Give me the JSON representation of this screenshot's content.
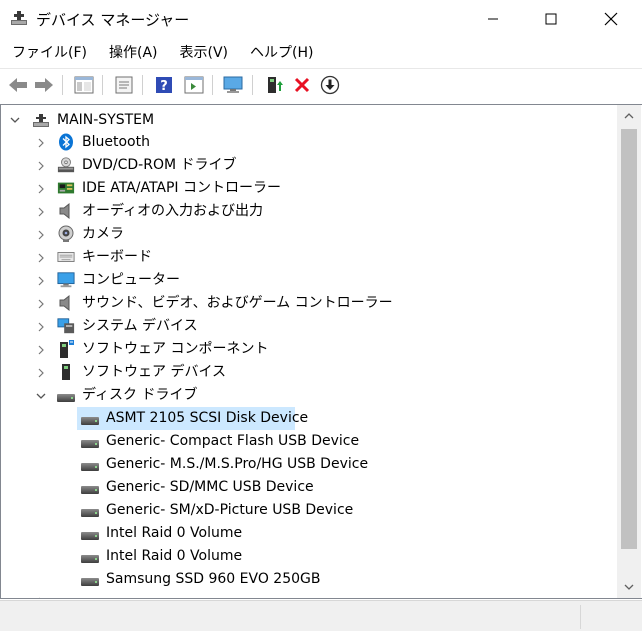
{
  "window": {
    "title": "デバイス マネージャー"
  },
  "menu": {
    "items": [
      "ファイル(F)",
      "操作(A)",
      "表示(V)",
      "ヘルプ(H)"
    ]
  },
  "tree": {
    "root": "MAIN-SYSTEM",
    "categories": [
      {
        "label": "Bluetooth",
        "icon": "bluetooth-icon",
        "expanded": false
      },
      {
        "label": "DVD/CD-ROM ドライブ",
        "icon": "optical-drive-icon",
        "expanded": false
      },
      {
        "label": "IDE ATA/ATAPI コントローラー",
        "icon": "ide-controller-icon",
        "expanded": false
      },
      {
        "label": "オーディオの入力および出力",
        "icon": "speaker-icon",
        "expanded": false
      },
      {
        "label": "カメラ",
        "icon": "camera-icon",
        "expanded": false
      },
      {
        "label": "キーボード",
        "icon": "keyboard-icon",
        "expanded": false
      },
      {
        "label": "コンピューター",
        "icon": "monitor-icon",
        "expanded": false
      },
      {
        "label": "サウンド、ビデオ、およびゲーム コントローラー",
        "icon": "speaker-icon",
        "expanded": false
      },
      {
        "label": "システム デバイス",
        "icon": "system-devices-icon",
        "expanded": false
      },
      {
        "label": "ソフトウェア コンポーネント",
        "icon": "software-component-icon",
        "expanded": false
      },
      {
        "label": "ソフトウェア デバイス",
        "icon": "software-device-icon",
        "expanded": false
      },
      {
        "label": "ディスク ドライブ",
        "icon": "disk-drive-icon",
        "expanded": true
      }
    ],
    "disk_devices": [
      {
        "label": "ASMT 2105 SCSI Disk Device",
        "selected": true
      },
      {
        "label": "Generic- Compact Flash USB Device",
        "selected": false
      },
      {
        "label": "Generic- M.S./M.S.Pro/HG USB Device",
        "selected": false
      },
      {
        "label": "Generic- SD/MMC USB Device",
        "selected": false
      },
      {
        "label": "Generic- SM/xD-Picture USB Device",
        "selected": false
      },
      {
        "label": "Intel Raid 0 Volume",
        "selected": false
      },
      {
        "label": "Intel Raid 0 Volume",
        "selected": false
      },
      {
        "label": "Samsung SSD 960 EVO 250GB",
        "selected": false
      }
    ]
  },
  "colors": {
    "selection": "#cce8ff",
    "accent": "#0078d7",
    "delete_red": "#e81123"
  }
}
